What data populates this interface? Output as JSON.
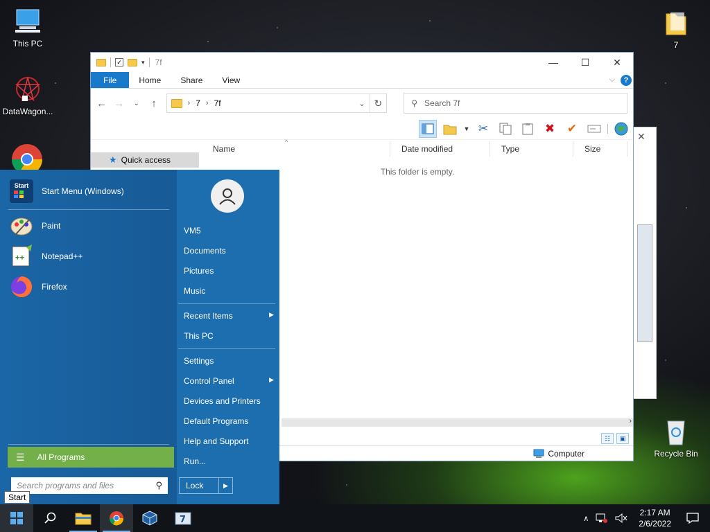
{
  "desktop": {
    "icons": [
      {
        "label": "This PC"
      },
      {
        "label": "DataWagon..."
      },
      {
        "label": "7"
      },
      {
        "label": "Recycle Bin"
      }
    ]
  },
  "explorer": {
    "title": "7f",
    "ribbon": {
      "file": "File",
      "home": "Home",
      "share": "Share",
      "view": "View"
    },
    "breadcrumb": [
      "7",
      "7f"
    ],
    "search_placeholder": "Search 7f",
    "nav": {
      "quick_access": "Quick access"
    },
    "columns": [
      "Name",
      "Date modified",
      "Type",
      "Size"
    ],
    "empty_message": "This folder is empty.",
    "status": {
      "location": "Computer"
    }
  },
  "startmenu": {
    "pinned": [
      {
        "label": "Start Menu (Windows)",
        "icon": "start-menu-icon"
      },
      {
        "label": "Paint",
        "icon": "paint-icon"
      },
      {
        "label": "Notepad++",
        "icon": "notepadpp-icon"
      },
      {
        "label": "Firefox",
        "icon": "firefox-icon"
      }
    ],
    "start_icon_text": "Start",
    "all_programs": "All Programs",
    "search_placeholder": "Search programs and files",
    "user": "VM5",
    "links": {
      "documents": "Documents",
      "pictures": "Pictures",
      "music": "Music",
      "recent_items": "Recent Items",
      "this_pc": "This PC",
      "settings": "Settings",
      "control_panel": "Control Panel",
      "devices_printers": "Devices and Printers",
      "default_programs": "Default Programs",
      "help_support": "Help and Support",
      "run": "Run..."
    },
    "lock": "Lock",
    "tooltip": "Start"
  },
  "taskbar": {
    "time": "2:17 AM",
    "date": "2/6/2022"
  }
}
